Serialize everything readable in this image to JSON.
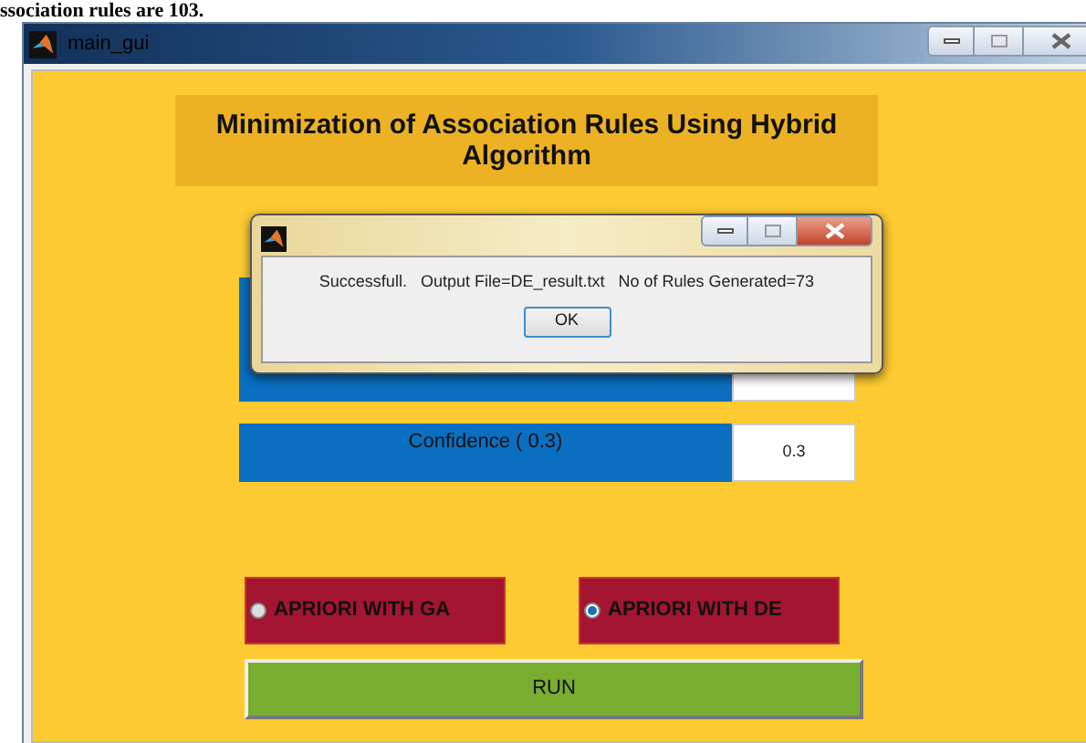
{
  "document_text": "ssociation rules are 103.",
  "window": {
    "title": "main_gui"
  },
  "banner": {
    "title": "Minimization of Association Rules Using Hybrid Algorithm"
  },
  "parameters": [
    {
      "label": "Confidence ( 0.3)",
      "value": "0.3"
    }
  ],
  "algorithms": [
    {
      "label": "APRIORI WITH GA",
      "selected": false
    },
    {
      "label": "APRIORI WITH DE",
      "selected": true
    }
  ],
  "run_button": "RUN",
  "dialog": {
    "message": "Successfull.   Output File=DE_result.txt   No of Rules Generated=73",
    "button": "OK"
  }
}
